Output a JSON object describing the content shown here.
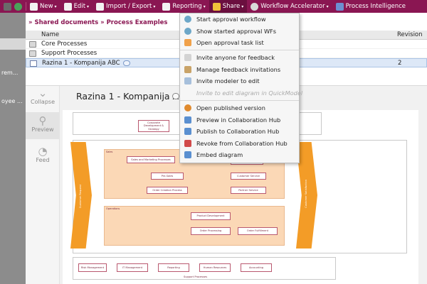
{
  "toolbar": {
    "items": [
      {
        "label": "New",
        "icon": "new-icon",
        "color": "#f2f2f2"
      },
      {
        "label": "Edit",
        "icon": "edit-icon",
        "color": "#f2f2f2"
      },
      {
        "label": "Import / Export",
        "icon": "import-export-icon",
        "color": "#f2f2f2"
      },
      {
        "label": "Reporting",
        "icon": "reporting-icon",
        "color": "#f2f2f2"
      },
      {
        "label": "Share",
        "icon": "share-icon",
        "color": "#f0c23a"
      },
      {
        "label": "Workflow Accelerator",
        "icon": "workflow-icon",
        "color": "#d9d9d9"
      },
      {
        "label": "Process Intelligence",
        "icon": "process-intelligence-icon",
        "color": "#6d8fd1"
      }
    ]
  },
  "left_panel": {
    "rows": [
      "rem...",
      "oyee ..."
    ]
  },
  "breadcrumb": "» Shared documents  » Process Examples",
  "file_table": {
    "headers": {
      "name": "Name",
      "revision": "Revision"
    },
    "rows": [
      {
        "name": "Core Processes",
        "revision": ""
      },
      {
        "name": "Support Processes",
        "revision": ""
      },
      {
        "name": "Razina 1 - Kompanija ABC",
        "revision": "2"
      }
    ]
  },
  "preview": {
    "collapse_label": "Collapse",
    "preview_label": "Preview",
    "feed_label": "Feed",
    "title": "Razina 1 - Kompanija ABC"
  },
  "diagram": {
    "top_box": "Corporate Development & Strategy",
    "lane1_label": "Sales",
    "lane2_label": "Operations",
    "left_arrow": "Customer Request",
    "right_arrow": "Customer Satisfaction",
    "shapes": {
      "sales_marketing": "Sales and Marketing Processes",
      "pre_sales": "Pre-Sales",
      "order_creation": "Order Creation Process",
      "after_sales": "After-Sales",
      "customer_service": "Customer Service",
      "partner_service": "Partner Service",
      "product_development": "Product Development",
      "order_processing": "Order Processing",
      "order_fulfillment": "Order Fulfillment"
    },
    "support": [
      "Risk Management",
      "IT Management",
      "Reporting",
      "Human Resources",
      "Accounting"
    ],
    "support_label": "Support Processes"
  },
  "share_menu": {
    "items": [
      {
        "label": "Start approval workflow",
        "icon": "approval-workflow-icon",
        "color": "#6da7c8",
        "disabled": false
      },
      {
        "label": "Show started approval WFs",
        "icon": "approval-list-icon",
        "color": "#6da7c8",
        "disabled": false
      },
      {
        "label": "Open approval task list",
        "icon": "task-list-icon",
        "color": "#f0a14a",
        "disabled": false
      },
      {
        "label": "Invite anyone for feedback",
        "icon": "feedback-icon",
        "color": "#d3d3d3",
        "disabled": false
      },
      {
        "label": "Manage feedback invitations",
        "icon": "manage-feedback-icon",
        "color": "#c9a368",
        "disabled": false
      },
      {
        "label": "Invite modeler to edit",
        "icon": "invite-modeler-icon",
        "color": "#a6bfdb",
        "disabled": false
      },
      {
        "label": "Invite to edit diagram in QuickModel",
        "icon": "quickmodel-icon",
        "color": "#e0e0e0",
        "disabled": true
      },
      {
        "label": "Open published version",
        "icon": "published-version-icon",
        "color": "#e08a2e",
        "disabled": false
      },
      {
        "label": "Preview in Collaboration Hub",
        "icon": "preview-hub-icon",
        "color": "#5a8fd0",
        "disabled": false
      },
      {
        "label": "Publish to Collaboration Hub",
        "icon": "publish-hub-icon",
        "color": "#5a8fd0",
        "disabled": false
      },
      {
        "label": "Revoke from Collaboration Hub",
        "icon": "revoke-hub-icon",
        "color": "#d14a4a",
        "disabled": false
      },
      {
        "label": "Embed diagram",
        "icon": "embed-icon",
        "color": "#5a8fd0",
        "disabled": false
      }
    ]
  }
}
